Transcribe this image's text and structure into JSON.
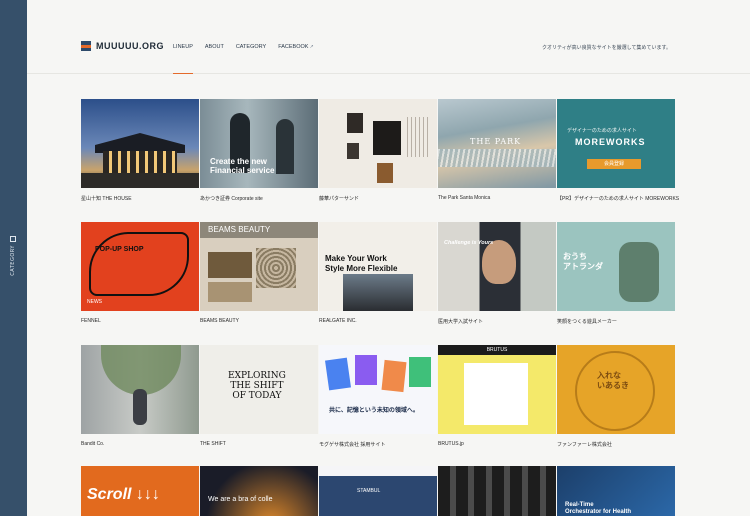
{
  "rail": {
    "label": "CATEGORY"
  },
  "header": {
    "logo": "MUUUUU.ORG",
    "nav": [
      {
        "label": "LINEUP"
      },
      {
        "label": "ABOUT"
      },
      {
        "label": "CATEGORY"
      },
      {
        "label": "FACEBOOK"
      }
    ],
    "facebook_ext": "↗",
    "tagline": "クオリティが高い良質なサイトを厳選して集めています。"
  },
  "thumbs": {
    "t2_headline": "Create the new\nFinancial service",
    "t4_logo": "THE PARK",
    "t5_top": "デザイナーのための求人サイト",
    "t5_brand": "MOREWORKS",
    "t5_button": "会員登録",
    "t6_text": "POP-UP SHOP",
    "t6_foot": "NEWS",
    "t7_bar": "BEAMS BEAUTY",
    "t8_headline": "Make Your Work\nStyle More Flexible",
    "t9_text": "Challenge is Yours",
    "t10_text": "おうち\nアトランダ",
    "t12_headline": "EXPLORING\nTHE SHIFT\nOF TODAY",
    "t13_text": "共に、記憶という未知の領域へ。",
    "t14_head": "BRUTUS",
    "t15_text": "入れな\nいあるき",
    "r4a": "Scroll ↓↓↓",
    "r4b": "We are a bra of colle",
    "r4c": "STAMBUL",
    "r4e": "Real-Time\nOrchestrator for Health"
  },
  "items": [
    {
      "caption": "星山十知 THE HOUSE"
    },
    {
      "caption": "あかつき証券 Corporate site"
    },
    {
      "caption": "藤華パターサンド"
    },
    {
      "caption": "The Park Santa Monica"
    },
    {
      "caption": "【PR】デザイナーのための求人サイト MOREWORKS"
    },
    {
      "caption": "FENNEL"
    },
    {
      "caption": "BEAMS BEAUTY"
    },
    {
      "caption": "REALGATE INC."
    },
    {
      "caption": "医用大学入試サイト"
    },
    {
      "caption": "笑顔をつくる遊具メーカー"
    },
    {
      "caption": "Bandit Co."
    },
    {
      "caption": "THE SHIFT"
    },
    {
      "caption": "モグゲサ株式会社 採用サイト"
    },
    {
      "caption": "BRUTUS.jp"
    },
    {
      "caption": "ファンファーレ株式会社"
    }
  ]
}
